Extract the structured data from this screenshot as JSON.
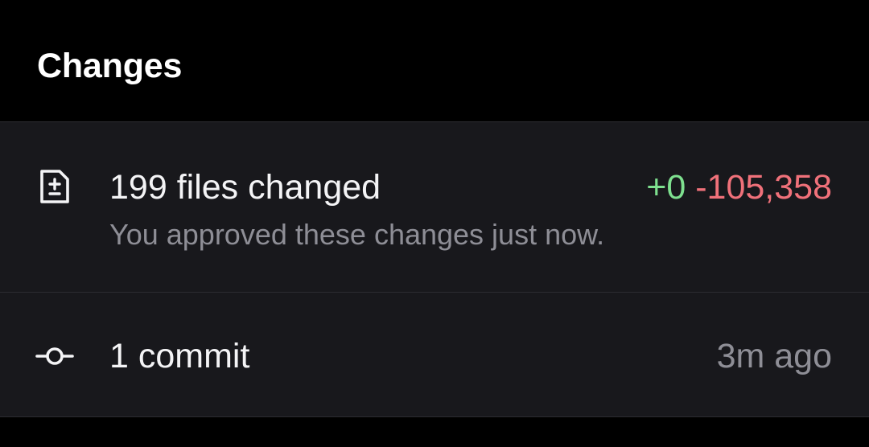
{
  "header": {
    "title": "Changes"
  },
  "files_row": {
    "icon": "file-diff-icon",
    "title": "199 files changed",
    "subtitle": "You approved these changes just now.",
    "additions": "+0",
    "deletions": "-105,358"
  },
  "commits_row": {
    "icon": "git-commit-icon",
    "title": "1 commit",
    "time": "3m ago"
  },
  "colors": {
    "background": "#000000",
    "card": "#18181c",
    "divider": "#2c2c31",
    "primary_text": "#f4f4f6",
    "secondary_text": "#8e8e96",
    "additions": "#7ee08f",
    "deletions": "#f0717a"
  }
}
